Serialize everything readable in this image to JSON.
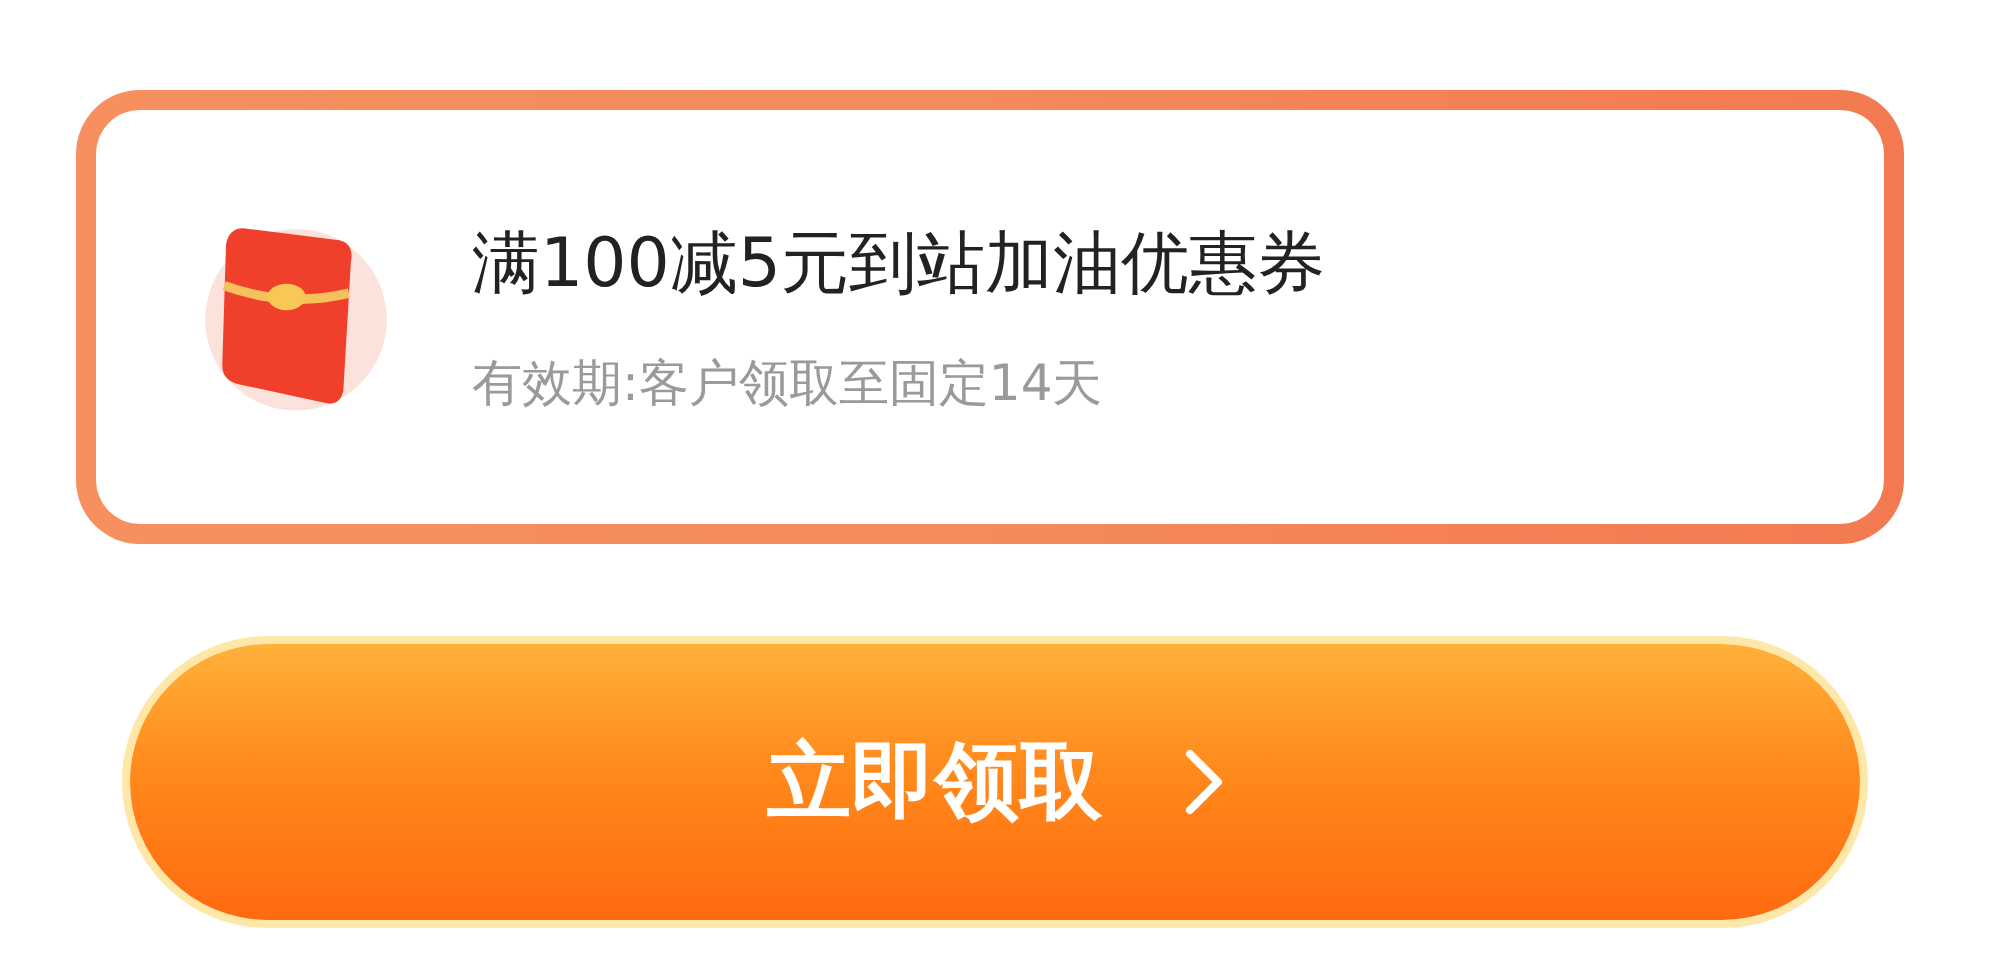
{
  "coupon": {
    "title": "满100减5元到站加油优惠券",
    "validity": "有效期:客户领取至固定14天"
  },
  "claim_button": {
    "label": "立即领取"
  }
}
